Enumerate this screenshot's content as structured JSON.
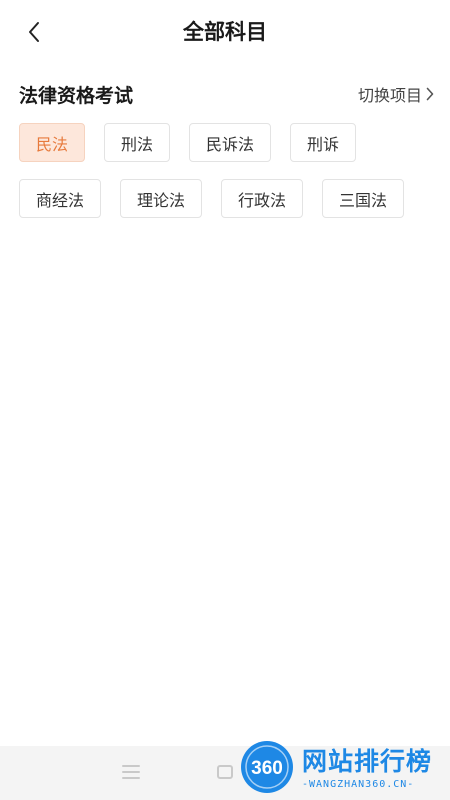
{
  "header": {
    "title": "全部科目",
    "back_icon": "chevron-left-icon"
  },
  "section": {
    "title": "法律资格考试",
    "switch_label": "切换项目",
    "switch_icon": "chevron-right-icon"
  },
  "subjects": [
    {
      "label": "民法",
      "selected": true
    },
    {
      "label": "刑法",
      "selected": false
    },
    {
      "label": "民诉法",
      "selected": false
    },
    {
      "label": "刑诉",
      "selected": false
    },
    {
      "label": "商经法",
      "selected": false
    },
    {
      "label": "理论法",
      "selected": false
    },
    {
      "label": "行政法",
      "selected": false
    },
    {
      "label": "三国法",
      "selected": false
    }
  ],
  "colors": {
    "accent_text": "#e77a3c",
    "accent_bg": "#fde7db",
    "watermark_blue": "#1e88e5"
  },
  "navbar": {
    "icons": [
      "menu-icon",
      "home-square-icon"
    ]
  },
  "watermark": {
    "logo_text": "360",
    "title": "网站排行榜",
    "subtitle": "-WANGZHAN360.CN-"
  }
}
